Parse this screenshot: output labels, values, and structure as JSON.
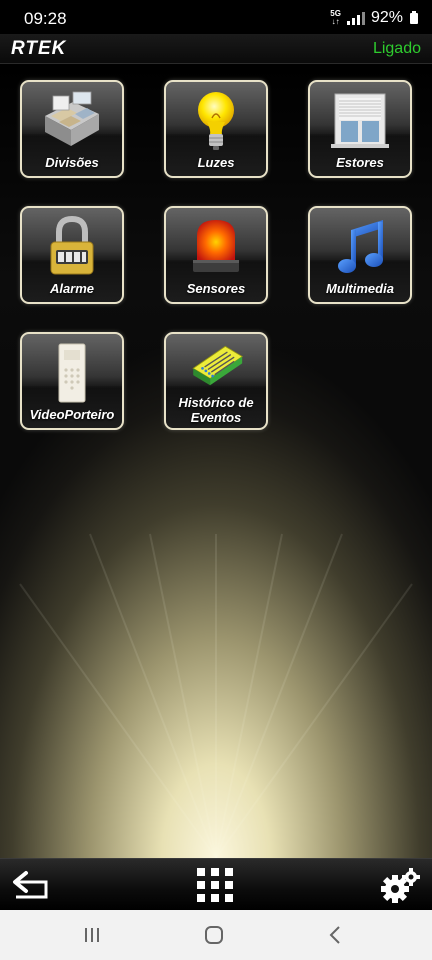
{
  "status_bar": {
    "time": "09:28",
    "network_top": "5G",
    "network_bottom": "↓↑",
    "battery": "92%"
  },
  "header": {
    "logo": "RTEK",
    "connection_status": "Ligado",
    "connection_color": "#2ecc2e"
  },
  "tiles": [
    {
      "label": "Divisões",
      "icon": "house-rooms-icon"
    },
    {
      "label": "Luzes",
      "icon": "light-bulb-icon"
    },
    {
      "label": "Estores",
      "icon": "window-shutter-icon"
    },
    {
      "label": "Alarme",
      "icon": "padlock-icon"
    },
    {
      "label": "Sensores",
      "icon": "siren-icon"
    },
    {
      "label": "Multimedia",
      "icon": "music-note-icon"
    },
    {
      "label": "VideoPorteiro",
      "icon": "intercom-icon"
    },
    {
      "label": "Histórico de Eventos",
      "icon": "event-log-book-icon"
    }
  ],
  "toolbar": {
    "back": "back-arrow-icon",
    "menu": "grid-menu-icon",
    "settings": "gears-icon"
  },
  "android_nav": {
    "recents": "recents-icon",
    "home": "home-icon",
    "back": "back-chevron-icon"
  }
}
